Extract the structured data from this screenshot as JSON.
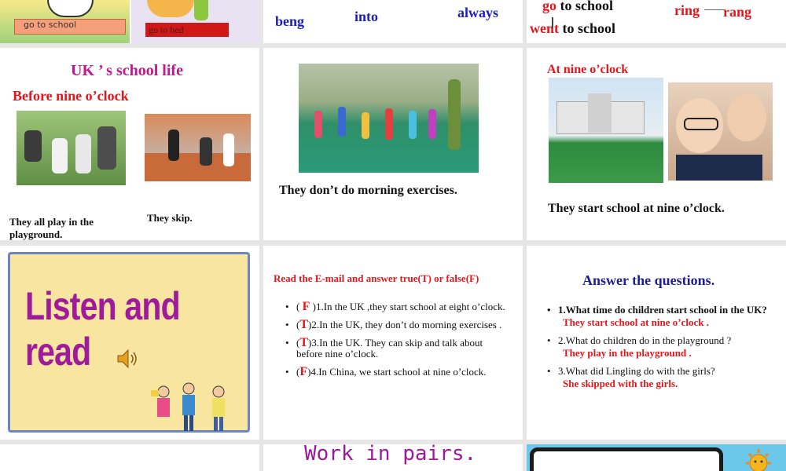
{
  "slide1": {
    "caption_left": "go to school",
    "caption_right": "go to bed"
  },
  "slide2": {
    "words": [
      "beng",
      "into",
      "always"
    ]
  },
  "slide3": {
    "line1_word": "go",
    "line1_rest": " to school",
    "line2_word": "went",
    "line2_rest": " to school",
    "ring": "ring",
    "rang": "rang"
  },
  "slide4": {
    "title": "UK ’ s school life",
    "subtitle": "Before nine o’clock",
    "caption1": "They all play in the playground.",
    "caption2": "They skip."
  },
  "slide5": {
    "caption": "They don’t do morning exercises."
  },
  "slide6": {
    "title": "At nine o’clock",
    "caption": "They start school at nine o’clock."
  },
  "slide7": {
    "title": "Listen and read",
    "icon": "speaker-icon"
  },
  "slide8": {
    "title": "Read the E-mail and answer true(T) or false(F)",
    "items": [
      {
        "mark": "F",
        "open": "( ",
        "close": " )1.In the UK ,they start school at eight o’clock."
      },
      {
        "mark": "T",
        "open": "(",
        "close": ")2.In the UK, they don’t do morning exercises ."
      },
      {
        "mark": "T",
        "open": "(",
        "close": ")3.In the UK. They can skip and talk about before nine o’clock."
      },
      {
        "mark": "F",
        "open": "(",
        "close": ")4.In China, we start school at nine o’clock."
      }
    ]
  },
  "slide9": {
    "title": "Answer the questions.",
    "questions": [
      {
        "q": "1.What time do children start school in the UK?",
        "a": "They start school at nine o’clock ."
      },
      {
        "q": "2.What do children do in the playground ?",
        "a": "They play in the playground ."
      },
      {
        "q": "3.What did Lingling do with the girls?",
        "a": "She skipped with the girls."
      }
    ]
  },
  "slide11": {
    "title": "Work in pairs."
  },
  "colors": {
    "accent_red": "#e4161b",
    "accent_blue": "#1d1db8",
    "accent_magenta": "#c0198f",
    "listen_bg": "#f8e6a0",
    "listen_border": "#6b86c2"
  }
}
